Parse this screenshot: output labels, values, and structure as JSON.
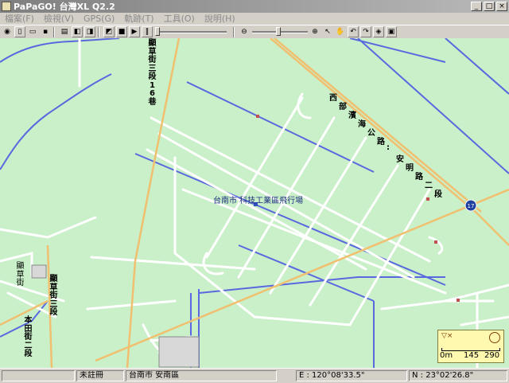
{
  "window": {
    "title": "PaPaGO! 台灣XL Q2.2",
    "btn_min": "_",
    "btn_max": "□",
    "btn_close": "×"
  },
  "menu": [
    {
      "label": "檔案(F)"
    },
    {
      "label": "檢視(V)"
    },
    {
      "label": "GPS(G)"
    },
    {
      "label": "軌跡(T)"
    },
    {
      "label": "工具(O)"
    },
    {
      "label": "說明(H)"
    }
  ],
  "map": {
    "place_label": "台南市 科技工業區飛行場",
    "route_badge": "17",
    "road_west_coast": [
      "西",
      "部",
      "濱",
      "海",
      "公",
      "路",
      ":",
      "安",
      "明",
      "路",
      "二",
      "段"
    ],
    "road_top_lane": [
      "顯",
      "草",
      "街",
      "三",
      "段",
      "1",
      "6",
      "巷"
    ],
    "road_left_lane_a": [
      "顯",
      "草",
      "街"
    ],
    "road_left_lane_b": [
      "顯",
      "草",
      "街",
      "三",
      "段"
    ],
    "road_left_lane_c": [
      "本",
      "田",
      "街",
      "二",
      "段"
    ]
  },
  "scale": {
    "label_0": "0m",
    "label_1": "145",
    "label_2": "290"
  },
  "status": {
    "registered": "未註冊",
    "city": "台南市 安南區",
    "east": "E : 120°08'33.5\"",
    "north": "N : 23°02'26.8\""
  },
  "colors": {
    "map_bg": "#c9f0c8",
    "minor_road": "#ffffff",
    "highway": "#f0c070",
    "blue_line": "#5a68e0"
  }
}
